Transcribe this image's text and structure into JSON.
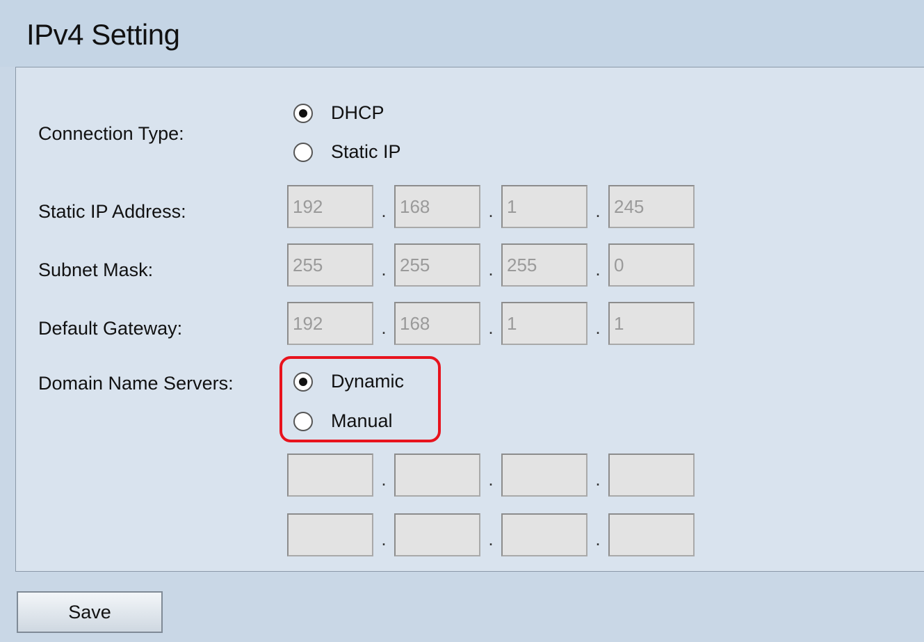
{
  "title": "IPv4 Setting",
  "connection_type": {
    "label": "Connection Type:",
    "options": [
      {
        "label": "DHCP",
        "checked": true
      },
      {
        "label": "Static IP",
        "checked": false
      }
    ]
  },
  "static_ip": {
    "label": "Static IP Address:",
    "octets": [
      "192",
      "168",
      "1",
      "245"
    ]
  },
  "subnet_mask": {
    "label": "Subnet Mask:",
    "octets": [
      "255",
      "255",
      "255",
      "0"
    ]
  },
  "default_gateway": {
    "label": "Default Gateway:",
    "octets": [
      "192",
      "168",
      "1",
      "1"
    ]
  },
  "dns": {
    "label": "Domain Name Servers:",
    "options": [
      {
        "label": "Dynamic",
        "checked": true
      },
      {
        "label": "Manual",
        "checked": false
      }
    ],
    "server1": [
      "",
      "",
      "",
      ""
    ],
    "server2": [
      "",
      "",
      "",
      ""
    ]
  },
  "save_label": "Save",
  "highlight_color": "#e8131d"
}
